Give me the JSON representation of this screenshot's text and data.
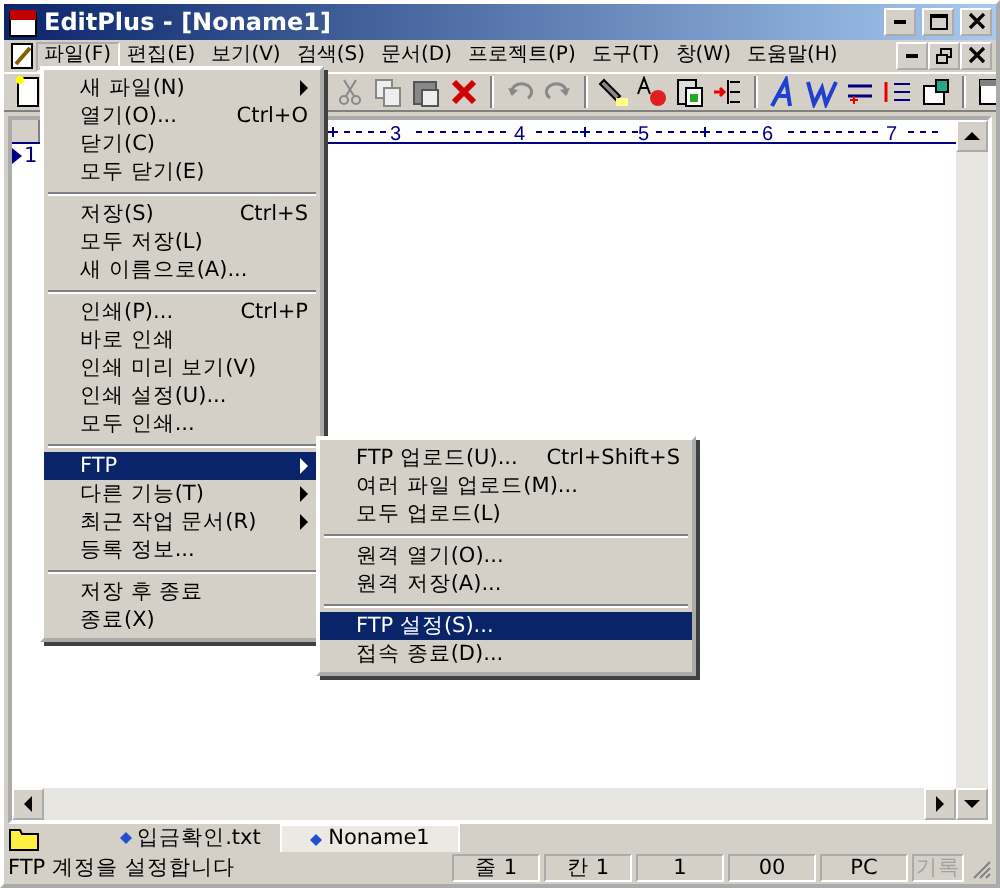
{
  "window": {
    "title": "EditPlus - [Noname1]"
  },
  "menu_bar": [
    {
      "label": "파일(F)",
      "selected": true
    },
    {
      "label": "편집(E)",
      "selected": false
    },
    {
      "label": "보기(V)",
      "selected": false
    },
    {
      "label": "검색(S)",
      "selected": false
    },
    {
      "label": "문서(D)",
      "selected": false
    },
    {
      "label": "프로젝트(P)",
      "selected": false
    },
    {
      "label": "도구(T)",
      "selected": false
    },
    {
      "label": "창(W)",
      "selected": false
    },
    {
      "label": "도움말(H)",
      "selected": false
    }
  ],
  "ruler": {
    "labels": [
      "3",
      "4",
      "5",
      "6",
      "7"
    ]
  },
  "editor": {
    "line_numbers": [
      "1"
    ]
  },
  "file_menu": [
    {
      "kind": "item",
      "label": "새 파일(N)",
      "submenu": true,
      "selected": false
    },
    {
      "kind": "item",
      "label": "열기(O)...",
      "shortcut": "Ctrl+O",
      "selected": false
    },
    {
      "kind": "item",
      "label": "닫기(C)",
      "selected": false
    },
    {
      "kind": "item",
      "label": "모두 닫기(E)",
      "selected": false
    },
    {
      "kind": "separator"
    },
    {
      "kind": "item",
      "label": "저장(S)",
      "shortcut": "Ctrl+S",
      "selected": false
    },
    {
      "kind": "item",
      "label": "모두 저장(L)",
      "selected": false
    },
    {
      "kind": "item",
      "label": "새 이름으로(A)...",
      "selected": false
    },
    {
      "kind": "separator"
    },
    {
      "kind": "item",
      "label": "인쇄(P)...",
      "shortcut": "Ctrl+P",
      "selected": false
    },
    {
      "kind": "item",
      "label": "바로 인쇄",
      "selected": false
    },
    {
      "kind": "item",
      "label": "인쇄 미리 보기(V)",
      "selected": false
    },
    {
      "kind": "item",
      "label": "인쇄 설정(U)...",
      "selected": false
    },
    {
      "kind": "item",
      "label": "모두 인쇄...",
      "selected": false
    },
    {
      "kind": "separator"
    },
    {
      "kind": "item",
      "label": "FTP",
      "submenu": true,
      "selected": true
    },
    {
      "kind": "item",
      "label": "다른 기능(T)",
      "submenu": true,
      "selected": false
    },
    {
      "kind": "item",
      "label": "최근 작업 문서(R)",
      "submenu": true,
      "selected": false
    },
    {
      "kind": "item",
      "label": "등록 정보...",
      "selected": false
    },
    {
      "kind": "separator"
    },
    {
      "kind": "item",
      "label": "저장 후 종료",
      "selected": false
    },
    {
      "kind": "item",
      "label": "종료(X)",
      "selected": false
    }
  ],
  "ftp_submenu": [
    {
      "kind": "item",
      "label": "FTP 업로드(U)...",
      "shortcut": "Ctrl+Shift+S",
      "selected": false
    },
    {
      "kind": "item",
      "label": "여러 파일 업로드(M)...",
      "selected": false
    },
    {
      "kind": "item",
      "label": "모두 업로드(L)",
      "selected": false
    },
    {
      "kind": "separator"
    },
    {
      "kind": "item",
      "label": "원격 열기(O)...",
      "selected": false
    },
    {
      "kind": "item",
      "label": "원격 저장(A)...",
      "selected": false
    },
    {
      "kind": "separator"
    },
    {
      "kind": "item",
      "label": "FTP 설정(S)...",
      "selected": true
    },
    {
      "kind": "item",
      "label": "접속 종료(D)...",
      "selected": false
    }
  ],
  "document_tabs": [
    {
      "label": "입금확인.txt",
      "selected": false
    },
    {
      "label": "Noname1",
      "selected": true
    }
  ],
  "status_bar": {
    "message": "FTP 계정을 설정합니다",
    "panes": [
      {
        "text": "줄 1",
        "disabled": false
      },
      {
        "text": "칸 1",
        "disabled": false
      },
      {
        "text": "1",
        "disabled": false
      },
      {
        "text": "00",
        "disabled": false
      },
      {
        "text": "PC",
        "disabled": false
      },
      {
        "text": "기록",
        "disabled": true
      }
    ]
  }
}
